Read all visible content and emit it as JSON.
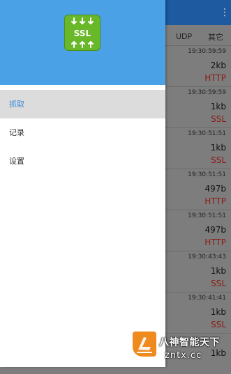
{
  "background": {
    "menu_icon": "overflow-menu-icon",
    "header": {
      "udp": "UDP",
      "other": "其它"
    },
    "rows": [
      {
        "time": "19:30:59:59",
        "size": "2kb",
        "protocol": "HTTP"
      },
      {
        "time": "19:30:59:59",
        "size": "1kb",
        "protocol": "SSL"
      },
      {
        "time": "19:30:51:51",
        "size": "1kb",
        "protocol": "SSL"
      },
      {
        "time": "19:30:51:51",
        "size": "497b",
        "protocol": "HTTP"
      },
      {
        "time": "19:30:51:51",
        "size": "497b",
        "protocol": "HTTP"
      },
      {
        "time": "19:30:43:43",
        "size": "1kb",
        "protocol": "SSL"
      },
      {
        "time": "19:30:41:41",
        "size": "1kb",
        "protocol": "SSL"
      },
      {
        "time": "",
        "size": "1kb",
        "protocol": ""
      }
    ]
  },
  "drawer": {
    "header": {
      "logo_text": "SSL",
      "color": "#4aa1e6"
    },
    "items": [
      {
        "label": "抓取",
        "active": true
      },
      {
        "label": "记录",
        "active": false
      },
      {
        "label": "设置",
        "active": false
      }
    ]
  },
  "watermark": {
    "title": "八神智能天下",
    "url": "zntx.cc"
  },
  "colors": {
    "accent": "#3d8bd8",
    "protocol": "#8a1b12",
    "active_bg": "#dcdcdc"
  }
}
